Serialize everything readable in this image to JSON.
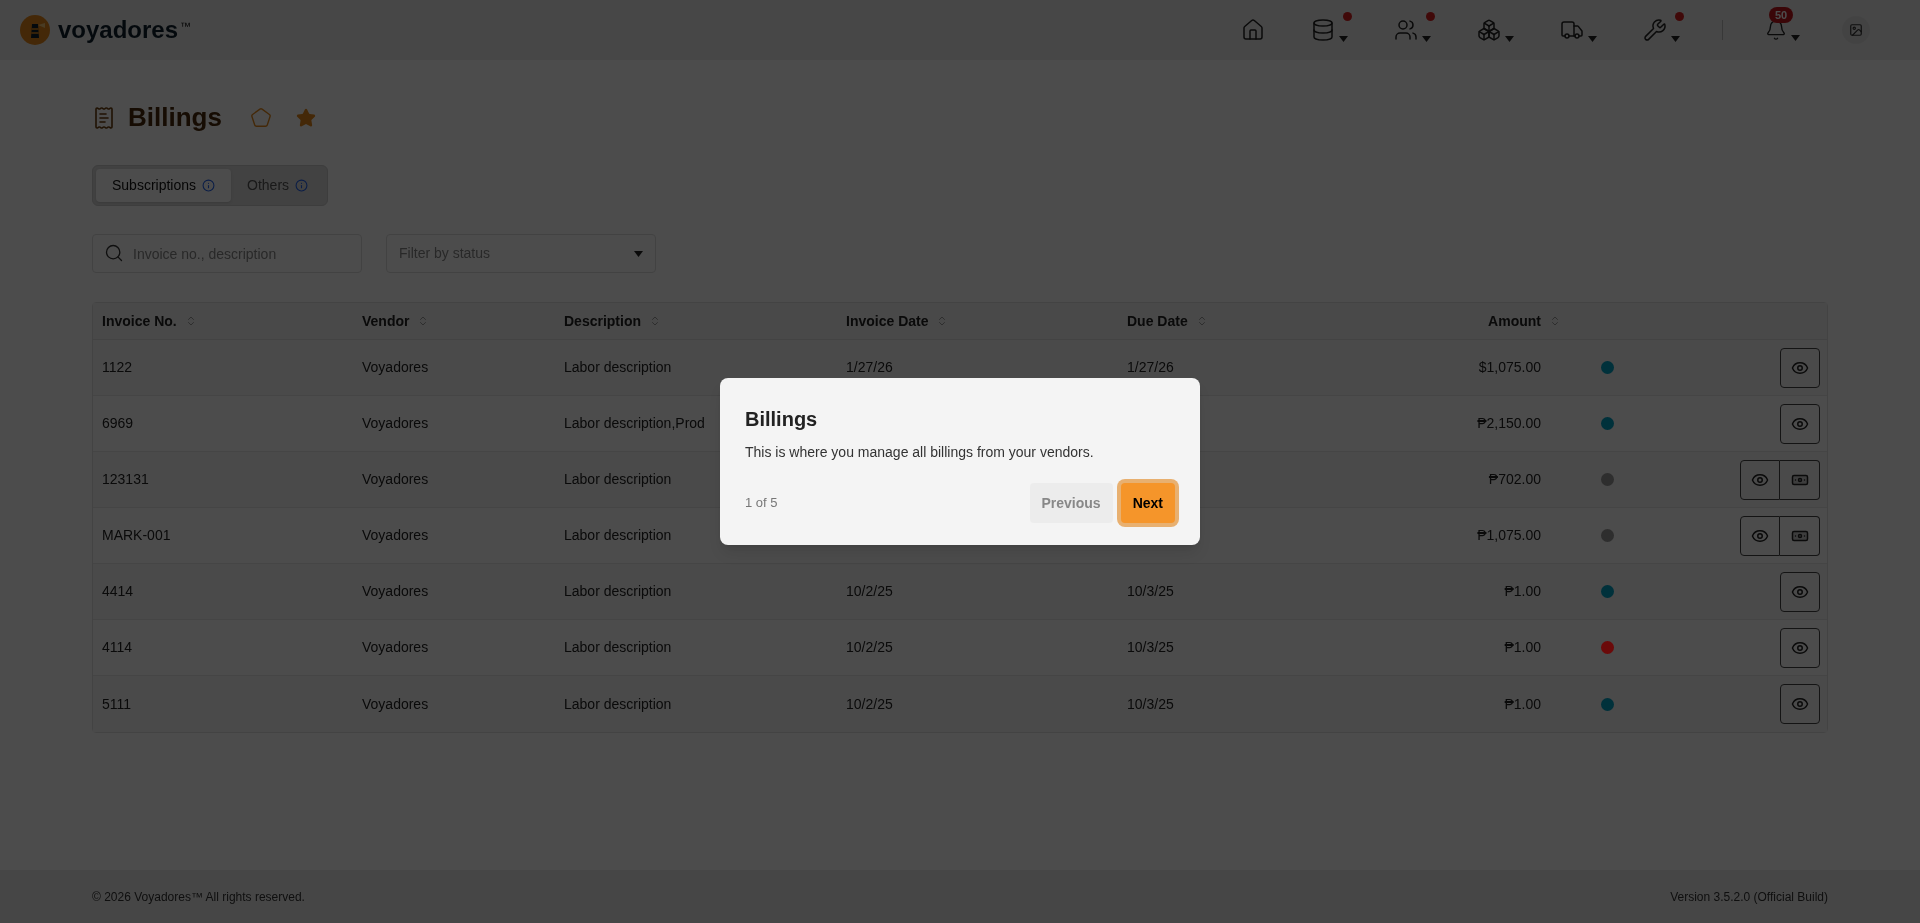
{
  "brand": {
    "name": "voyadores",
    "trademark": "™"
  },
  "nav": [
    {
      "kind": "home",
      "dot": false,
      "caret": false
    },
    {
      "kind": "database",
      "dot": true,
      "caret": true
    },
    {
      "kind": "users",
      "dot": true,
      "caret": true
    },
    {
      "kind": "boxes",
      "dot": false,
      "caret": true
    },
    {
      "kind": "truck",
      "dot": false,
      "caret": true
    },
    {
      "kind": "wrench",
      "dot": true,
      "caret": true
    }
  ],
  "notifications": {
    "count": "50"
  },
  "page": {
    "title": "Billings",
    "favorite": true
  },
  "tabs": [
    {
      "label": "Subscriptions",
      "selected": true
    },
    {
      "label": "Others",
      "selected": false
    }
  ],
  "search": {
    "placeholder": "Invoice no., description"
  },
  "status_filter": {
    "placeholder": "Filter by status"
  },
  "table": {
    "columns": [
      "Invoice No.",
      "Vendor",
      "Description",
      "Invoice Date",
      "Due Date",
      "Amount"
    ],
    "rows": [
      {
        "invoice_no": "1122",
        "vendor": "Voyadores",
        "description": "Labor description",
        "invoice_date": "1/27/26",
        "due_date": "1/27/26",
        "amount": "$1,075.00",
        "color": "#00313b",
        "actions": [
          {
            "kind": "view"
          }
        ]
      },
      {
        "invoice_no": "6969",
        "vendor": "Voyadores",
        "description": "Labor description,Prod",
        "amount": "₱2,150.00",
        "color": "#00313b",
        "actions": [
          {
            "kind": "view"
          }
        ]
      },
      {
        "invoice_no": "123131",
        "vendor": "Voyadores",
        "description": "Labor description",
        "amount": "₱702.00",
        "color": "#2e2e2e",
        "actions": [
          {
            "kind": "view"
          },
          {
            "kind": "pay"
          }
        ]
      },
      {
        "invoice_no": "MARK-001",
        "vendor": "Voyadores",
        "description": "Labor description",
        "amount": "₱1,075.00",
        "color": "#2e2e2e",
        "actions": [
          {
            "kind": "view"
          },
          {
            "kind": "pay"
          }
        ]
      },
      {
        "invoice_no": "4414",
        "vendor": "Voyadores",
        "description": "Labor description",
        "invoice_date": "10/2/25",
        "due_date": "10/3/25",
        "amount": "₱1.00",
        "color": "#00313b",
        "actions": [
          {
            "kind": "view"
          }
        ]
      },
      {
        "invoice_no": "4114",
        "vendor": "Voyadores",
        "description": "Labor description",
        "invoice_date": "10/2/25",
        "due_date": "10/3/25",
        "amount": "₱1.00",
        "color": "#6b0a0a",
        "actions": [
          {
            "kind": "view"
          }
        ]
      },
      {
        "invoice_no": "5111",
        "vendor": "Voyadores",
        "description": "Labor description",
        "invoice_date": "10/2/25",
        "due_date": "10/3/25",
        "amount": "₱1.00",
        "color": "#00313b",
        "actions": [
          {
            "kind": "view"
          }
        ]
      }
    ]
  },
  "tour": {
    "title": "Billings",
    "body": "This is where you manage all billings from your vendors.",
    "step": "1 of 5",
    "buttons": [
      {
        "label": "Previous",
        "kind": "secondary"
      },
      {
        "label": "Next",
        "kind": "primary"
      }
    ]
  },
  "footer": {
    "copyright": "© 2026 Voyadores™ All rights reserved.",
    "version": "Version 3.5.2.0 (Official Build)"
  }
}
